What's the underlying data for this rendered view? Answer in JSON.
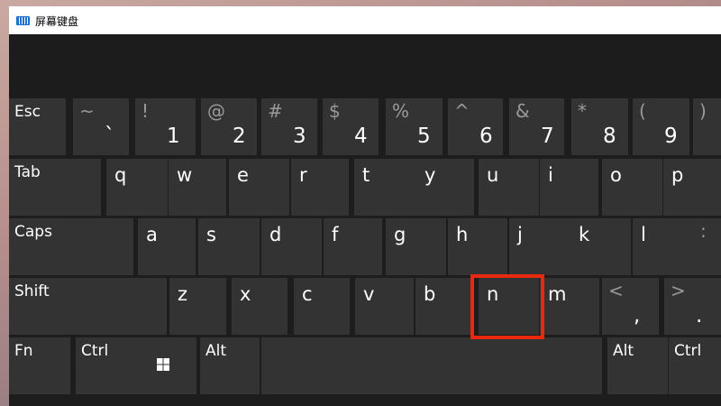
{
  "window": {
    "title": "屏幕键盘",
    "icon": "keyboard-icon"
  },
  "keyboard": {
    "rows": [
      {
        "name": "number-row",
        "keys": [
          {
            "label": "Esc",
            "kind": "word"
          },
          {
            "top": "~",
            "bottom": "`",
            "kind": "dual"
          },
          {
            "top": "!",
            "bottom": "1",
            "kind": "dual"
          },
          {
            "top": "@",
            "bottom": "2",
            "kind": "dual"
          },
          {
            "top": "#",
            "bottom": "3",
            "kind": "dual"
          },
          {
            "top": "$",
            "bottom": "4",
            "kind": "dual"
          },
          {
            "top": "%",
            "bottom": "5",
            "kind": "dual"
          },
          {
            "top": "^",
            "bottom": "6",
            "kind": "dual"
          },
          {
            "top": "&",
            "bottom": "7",
            "kind": "dual"
          },
          {
            "top": "*",
            "bottom": "8",
            "kind": "dual"
          },
          {
            "top": "(",
            "bottom": "9",
            "kind": "dual"
          },
          {
            "top": ")",
            "bottom": "",
            "kind": "dual"
          }
        ]
      },
      {
        "name": "top-letter-row",
        "keys": [
          {
            "label": "Tab",
            "kind": "word"
          },
          {
            "label": "q",
            "kind": "letter"
          },
          {
            "label": "w",
            "kind": "letter"
          },
          {
            "label": "e",
            "kind": "letter"
          },
          {
            "label": "r",
            "kind": "letter"
          },
          {
            "label": "t",
            "kind": "letter"
          },
          {
            "label": "y",
            "kind": "letter"
          },
          {
            "label": "u",
            "kind": "letter"
          },
          {
            "label": "i",
            "kind": "letter"
          },
          {
            "label": "o",
            "kind": "letter"
          },
          {
            "label": "p",
            "kind": "letter"
          }
        ]
      },
      {
        "name": "home-row",
        "keys": [
          {
            "label": "Caps",
            "kind": "word"
          },
          {
            "label": "a",
            "kind": "letter"
          },
          {
            "label": "s",
            "kind": "letter"
          },
          {
            "label": "d",
            "kind": "letter"
          },
          {
            "label": "f",
            "kind": "letter"
          },
          {
            "label": "g",
            "kind": "letter"
          },
          {
            "label": "h",
            "kind": "letter"
          },
          {
            "label": "j",
            "kind": "letter"
          },
          {
            "label": "k",
            "kind": "letter"
          },
          {
            "label": "l",
            "kind": "letter"
          },
          {
            "top": ":",
            "bottom": "",
            "kind": "dual"
          }
        ]
      },
      {
        "name": "bottom-letter-row",
        "keys": [
          {
            "label": "Shift",
            "kind": "word"
          },
          {
            "label": "z",
            "kind": "letter"
          },
          {
            "label": "x",
            "kind": "letter"
          },
          {
            "label": "c",
            "kind": "letter"
          },
          {
            "label": "v",
            "kind": "letter"
          },
          {
            "label": "b",
            "kind": "letter"
          },
          {
            "label": "n",
            "kind": "letter"
          },
          {
            "label": "m",
            "kind": "letter"
          },
          {
            "top": "<",
            "bottom": ",",
            "kind": "dual"
          },
          {
            "top": ">",
            "bottom": ".",
            "kind": "dual"
          }
        ]
      },
      {
        "name": "modifier-row",
        "keys": [
          {
            "label": "Fn",
            "kind": "word"
          },
          {
            "label": "Ctrl",
            "kind": "word"
          },
          {
            "label": "",
            "kind": "win",
            "icon": "windows-logo-icon"
          },
          {
            "label": "Alt",
            "kind": "word"
          },
          {
            "label": "",
            "kind": "space"
          },
          {
            "label": "Alt",
            "kind": "word"
          },
          {
            "label": "Ctrl",
            "kind": "word"
          }
        ]
      }
    ]
  },
  "annotation": {
    "highlighted_key": "n",
    "highlight_color": "#e8290f"
  },
  "colors": {
    "key_background": "#333333",
    "window_background": "#1d1d1d",
    "secondary_glyph": "#9a9a9a"
  }
}
